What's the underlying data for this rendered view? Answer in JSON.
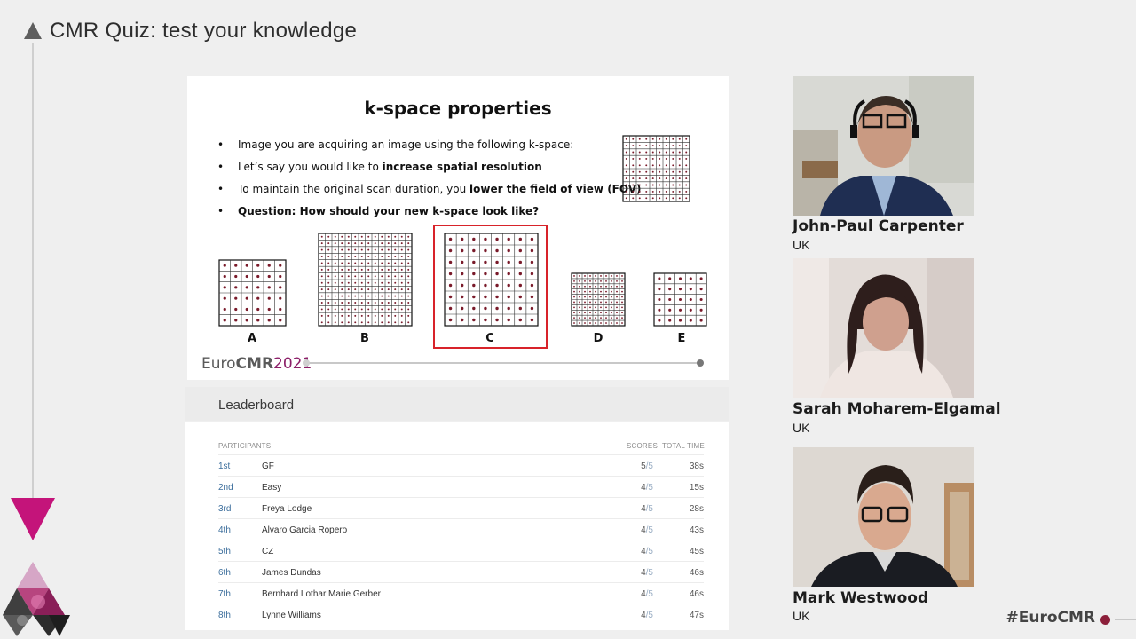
{
  "header": {
    "title": "CMR Quiz: test your knowledge"
  },
  "slide": {
    "title": "k-space properties",
    "bullets": [
      {
        "text": "Image you are acquiring an image using the following k-space:",
        "bold": ""
      },
      {
        "text": "Let’s say you would like to ",
        "bold": "increase spatial resolution"
      },
      {
        "text": "To maintain the original scan duration, you ",
        "bold": "lower the field of view (FOV)"
      },
      {
        "text": "",
        "bold": "Question: How should your new k-space look like?"
      }
    ],
    "bullet_symbol": "•",
    "options": [
      "A",
      "B",
      "C",
      "D",
      "E"
    ],
    "highlighted_option": "C",
    "logo": {
      "prefix": "Euro",
      "brand": "CMR",
      "year": "2021"
    }
  },
  "leaderboard": {
    "title": "Leaderboard",
    "columns": {
      "participants": "PARTICIPANTS",
      "scores": "SCORES",
      "total_time": "TOTAL TIME"
    },
    "rows": [
      {
        "rank": "1st",
        "name": "GF",
        "score": "5",
        "max": "/5",
        "time": "38s"
      },
      {
        "rank": "2nd",
        "name": "Easy",
        "score": "4",
        "max": "/5",
        "time": "15s"
      },
      {
        "rank": "3rd",
        "name": "Freya Lodge",
        "score": "4",
        "max": "/5",
        "time": "28s"
      },
      {
        "rank": "4th",
        "name": "Alvaro Garcia Ropero",
        "score": "4",
        "max": "/5",
        "time": "43s"
      },
      {
        "rank": "5th",
        "name": "CZ",
        "score": "4",
        "max": "/5",
        "time": "45s"
      },
      {
        "rank": "6th",
        "name": "James Dundas",
        "score": "4",
        "max": "/5",
        "time": "46s"
      },
      {
        "rank": "7th",
        "name": "Bernhard Lothar Marie Gerber",
        "score": "4",
        "max": "/5",
        "time": "46s"
      },
      {
        "rank": "8th",
        "name": "Lynne Williams",
        "score": "4",
        "max": "/5",
        "time": "47s"
      }
    ]
  },
  "speakers": [
    {
      "name": "John-Paul Carpenter",
      "country": "UK"
    },
    {
      "name": "Sarah Moharem-Elgamal",
      "country": "UK"
    },
    {
      "name": "Mark Westwood",
      "country": "UK"
    }
  ],
  "footer": {
    "hashtag": "#EuroCMR"
  },
  "colors": {
    "accent": "#8c1f68",
    "answer_frame": "#d8232a",
    "kspace_dot": "#7a1a2a",
    "magenta": "#c4147a"
  },
  "icons": [
    "title-triangle-icon",
    "magenta-triangle-icon",
    "eurocmr-logo-icon",
    "record-dot-icon"
  ]
}
